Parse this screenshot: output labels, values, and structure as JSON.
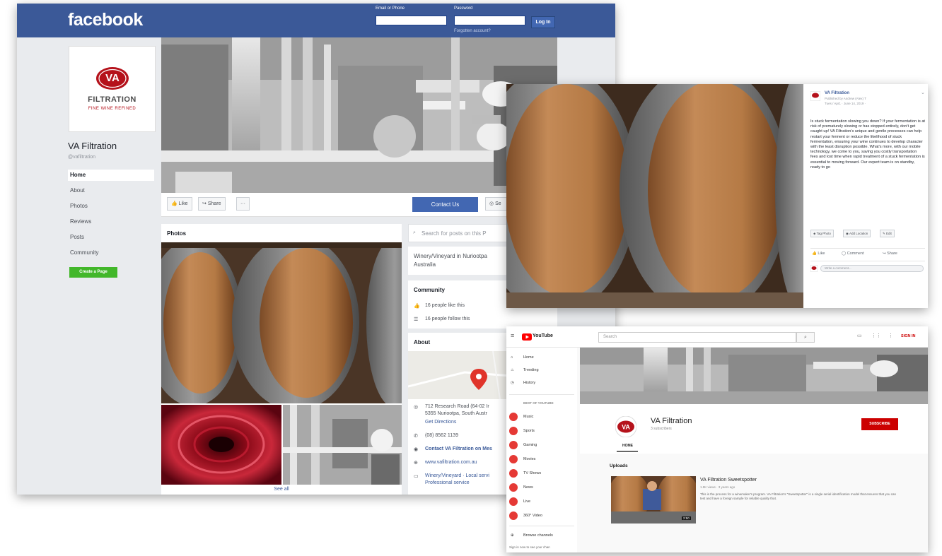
{
  "facebook": {
    "logo": "facebook",
    "login": {
      "email_label": "Email or Phone",
      "password_label": "Password",
      "login_button": "Log In",
      "forgot_link": "Forgotten account?"
    },
    "page_name": "VA Filtration",
    "page_handle": "@vafiltration",
    "profile_logo": {
      "monogram": "VA",
      "name": "FILTRATION",
      "tagline": "FINE WINE REFINED"
    },
    "nav": [
      "Home",
      "About",
      "Photos",
      "Reviews",
      "Posts",
      "Community"
    ],
    "create_page_button": "Create a Page",
    "actions": {
      "like": "Like",
      "share": "Share",
      "more": "···",
      "contact": "Contact Us",
      "send": "Se"
    },
    "photos": {
      "title": "Photos",
      "see_all": "See all"
    },
    "search_placeholder": "Search for posts on this P",
    "category_line1": "Winery/Vineyard in Nuriootpa",
    "category_line2": "Australia",
    "community": {
      "title": "Community",
      "likes": "16 people like this",
      "follows": "16 people follow this"
    },
    "about": {
      "title": "About",
      "address_line1": "712 Research Road (64-02 Ir",
      "address_line2": "5355 Nuriootpa, South Austr",
      "directions": "Get Directions",
      "phone": "(08) 8562 1139",
      "messenger": "Contact VA Filtration on Mes",
      "website": "www.vafiltration.com.au",
      "category_line1": "Winery/Vineyard · Local servi",
      "category_line2": "Professional service"
    }
  },
  "post": {
    "page_name": "VA Filtration",
    "meta_line1": "Published by Andrew (Alex) T",
    "meta_line2": "Tues / Apr1 · June 14, 2019 · ",
    "body": "Is stuck fermentation slowing you down? If your fermentation is at risk of prematurely slowing or has stopped entirely, don't get caught up! VA Filtration's unique and gentle processes can help restart your ferment or reduce the likelihood of stuck fermentation, ensuring your wine continues to develop character with the least disruption possible. What's more, with our mobile technology, we come to you, saving you costly transportation fees and lost time when rapid treatment of a stuck fermentation is essential to moving forward. Our expert team is on standby, ready to go",
    "tag_photo": "Tag Photo",
    "add_location": "Add Location",
    "edit": "Edit",
    "like": "Like",
    "comment": "Comment",
    "share": "Share",
    "comment_placeholder": "Write a comment..."
  },
  "youtube": {
    "logo": "YouTube",
    "search_placeholder": "Search",
    "sign_in": "SIGN IN",
    "sidebar_top": [
      "Home",
      "Trending",
      "History"
    ],
    "best_of_heading": "BEST OF YOUTUBE",
    "sidebar_best": [
      "Music",
      "Sports",
      "Gaming",
      "Movies",
      "TV Shows",
      "News",
      "Live",
      "360° Video"
    ],
    "browse_channels": "Browse channels",
    "signin_prompt": "Sign in now to see your chan",
    "channel_name": "VA Filtration",
    "subscribers": "3 subscribers",
    "subscribe_button": "SUBSCRIBE",
    "tab_home": "HOME",
    "uploads_heading": "Uploads",
    "video": {
      "title": "VA Filtration Sweetspotter",
      "meta": "1.9K views · 3 years ago",
      "description": "This is the process for a winemaker's program. VA Filtration's \"Sweetspotter\" is a single serial identification model that ensures that you can test and have a foreign sample for reliable quality that.",
      "duration": "2:50"
    }
  },
  "colors": {
    "facebook_blue": "#3b5998",
    "button_blue": "#4267b2",
    "create_green": "#42b72a",
    "youtube_red": "#ff0000",
    "va_red": "#b5121b"
  }
}
